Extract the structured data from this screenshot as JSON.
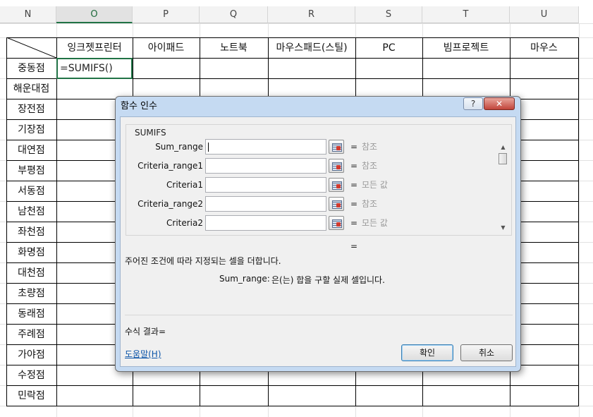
{
  "columns": [
    "N",
    "O",
    "P",
    "Q",
    "R",
    "S",
    "T",
    "U"
  ],
  "selected_column": "O",
  "table": {
    "headers": [
      "잉크젯프린터",
      "아이패드",
      "노트북",
      "마우스패드(스틸)",
      "PC",
      "빔프로젝트",
      "마우스"
    ],
    "rows": [
      "중동점",
      "해운대점",
      "장전점",
      "기장점",
      "대연점",
      "부평점",
      "서동점",
      "남천점",
      "좌천점",
      "화명점",
      "대천점",
      "초량점",
      "동래점",
      "주례점",
      "가야점",
      "수정점",
      "민락점"
    ]
  },
  "active_cell": {
    "value": "=SUMIFS()"
  },
  "dialog": {
    "title": "함수 인수",
    "help_icon": "?",
    "close_icon": "✕",
    "function_name": "SUMIFS",
    "arguments": [
      {
        "label": "Sum_range",
        "value": "",
        "hint": "참조"
      },
      {
        "label": "Criteria_range1",
        "value": "",
        "hint": "참조"
      },
      {
        "label": "Criteria1",
        "value": "",
        "hint": "모든 값"
      },
      {
        "label": "Criteria_range2",
        "value": "",
        "hint": "참조"
      },
      {
        "label": "Criteria2",
        "value": "",
        "hint": "모든 값"
      }
    ],
    "equals": "=",
    "result_equals": "=",
    "description": "주어진 조건에 따라 지정되는 셀을 더합니다.",
    "arg_desc_label": "Sum_range:",
    "arg_desc_text": "은(는) 합을 구할 실제 셀입니다.",
    "formula_result_label": "수식 결과=",
    "help_link": "도움말(H)",
    "ok_label": "확인",
    "cancel_label": "취소"
  }
}
